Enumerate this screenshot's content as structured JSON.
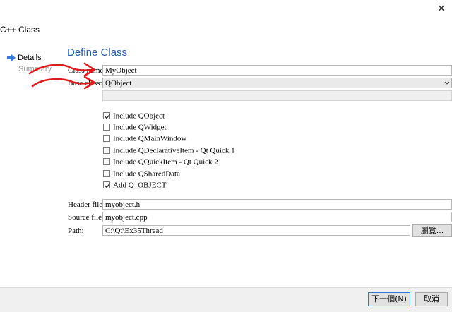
{
  "window": {
    "title": "C++ Class",
    "close_glyph": "✕"
  },
  "nav": {
    "items": [
      {
        "label": "Details",
        "active": true
      },
      {
        "label": "Summary",
        "active": false
      }
    ]
  },
  "page": {
    "heading": "Define Class"
  },
  "form": {
    "class_name_label": "Class name:",
    "class_name_value": "MyObject",
    "base_class_label": "Base class:",
    "base_class_value": "QObject"
  },
  "checkboxes": [
    {
      "label": "Include QObject",
      "checked": true
    },
    {
      "label": "Include QWidget",
      "checked": false
    },
    {
      "label": "Include QMainWindow",
      "checked": false
    },
    {
      "label": "Include QDeclarativeItem - Qt Quick 1",
      "checked": false
    },
    {
      "label": "Include QQuickItem - Qt Quick 2",
      "checked": false
    },
    {
      "label": "Include QSharedData",
      "checked": false
    },
    {
      "label": "Add Q_OBJECT",
      "checked": true
    }
  ],
  "files": {
    "header_label": "Header file:",
    "header_value": "myobject.h",
    "source_label": "Source file:",
    "source_value": "myobject.cpp",
    "path_label": "Path:",
    "path_value": "C:\\Qt\\Ex35Thread",
    "browse_label": "瀏覽..."
  },
  "footer": {
    "next_label": "下一個(N)",
    "cancel_label": "取消"
  },
  "colors": {
    "heading": "#2a5ea8",
    "annotation": "#e01b1b",
    "nav_arrow": "#3c78d8"
  },
  "icons": {
    "nav_active": "arrow-right-icon",
    "combo": "chevron-down-icon",
    "check": "check-icon"
  }
}
